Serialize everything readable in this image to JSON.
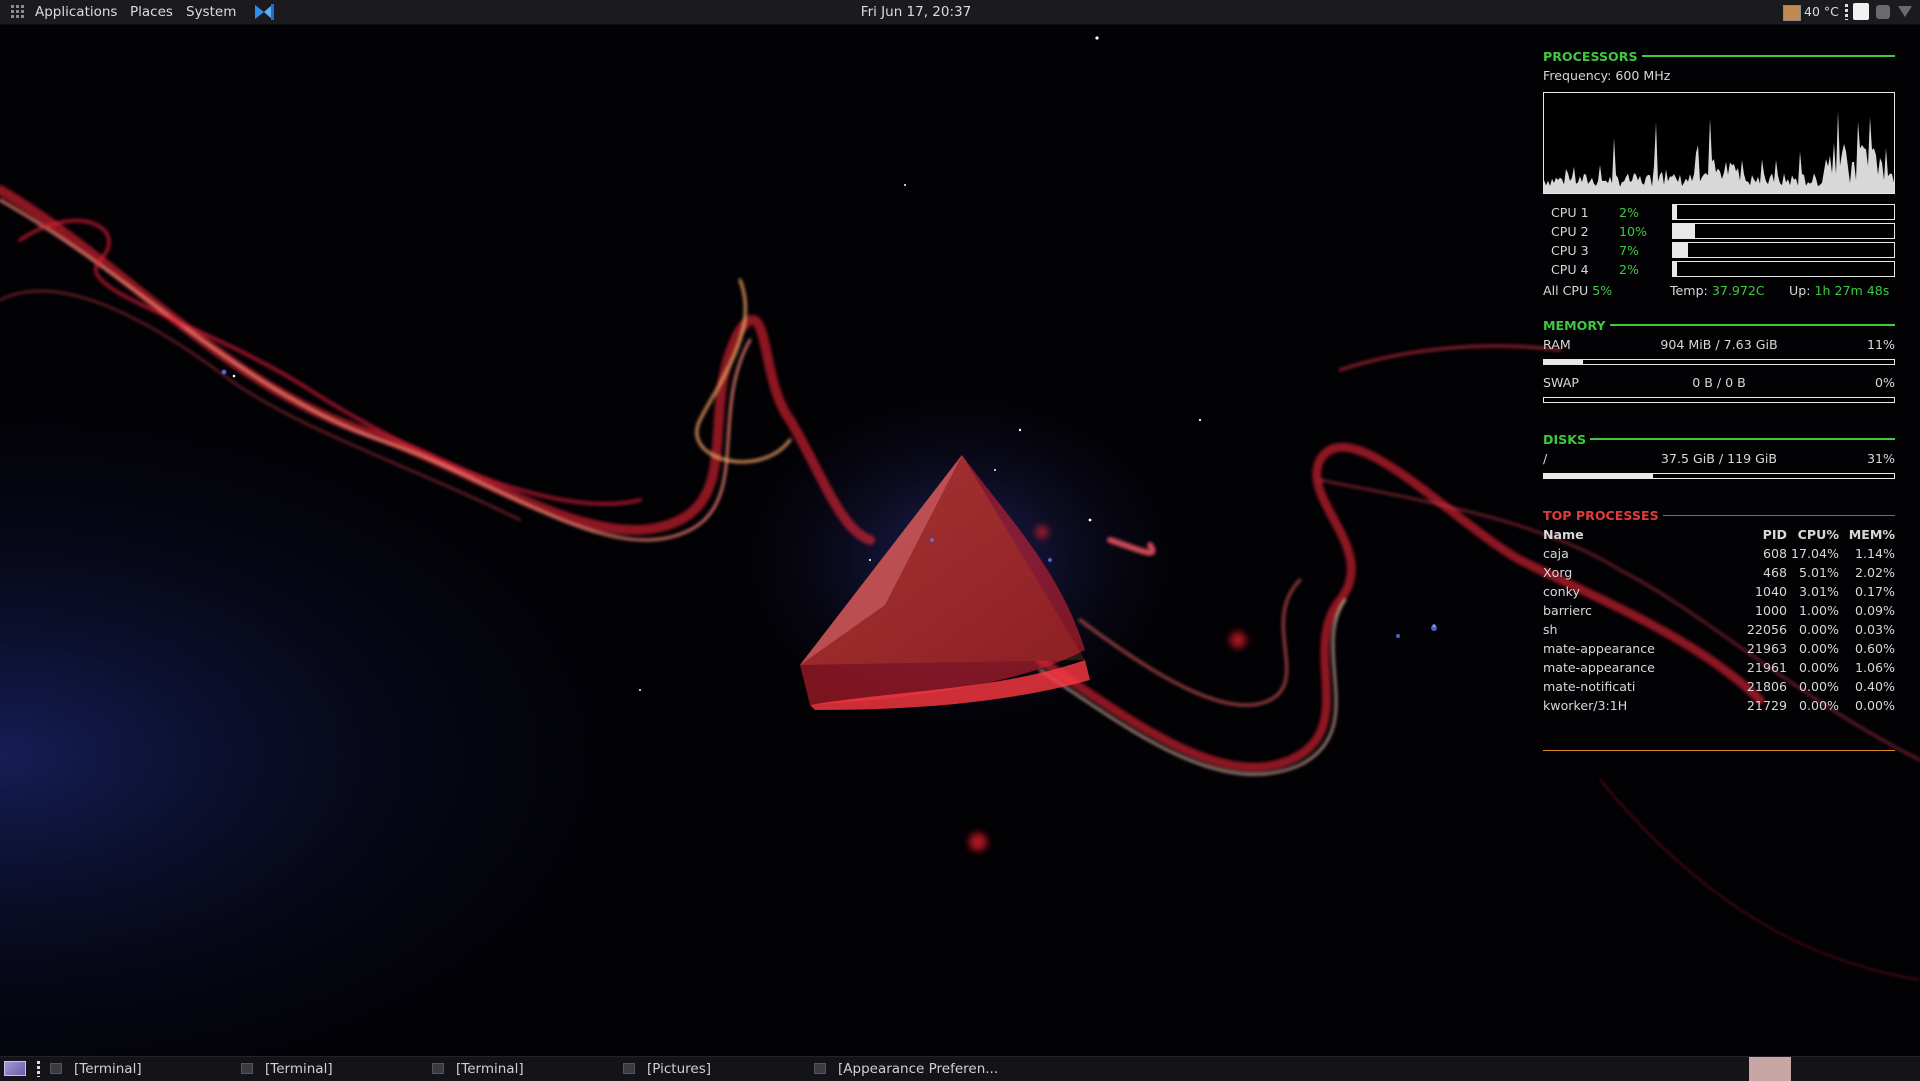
{
  "top_panel": {
    "menus": [
      "Applications",
      "Places",
      "System"
    ],
    "clock": "Fri Jun 17, 20:37",
    "temperature": "40 °C",
    "tray_icons": [
      "weather-icon",
      "network-icon",
      "volume-icon",
      "wifi-icon"
    ]
  },
  "conky": {
    "processors": {
      "title": "PROCESSORS",
      "frequency": "Frequency: 600 MHz",
      "cpus": [
        {
          "label": "CPU 1",
          "value": "2%",
          "fraction": 0.02
        },
        {
          "label": "CPU 2",
          "value": "10%",
          "fraction": 0.1
        },
        {
          "label": "CPU 3",
          "value": "7%",
          "fraction": 0.07
        },
        {
          "label": "CPU 4",
          "value": "2%",
          "fraction": 0.02
        }
      ],
      "all_cpu_label": "All CPU",
      "all_cpu_value": "5%",
      "temp_label": "Temp:",
      "temp_value": "37.972C",
      "uptime_label": "Up:",
      "uptime_value": "1h 27m 48s"
    },
    "memory": {
      "title": "MEMORY",
      "ram_label": "RAM",
      "ram_value": "904 MiB / 7.63 GiB",
      "ram_percent": "11%",
      "ram_fraction": 0.11,
      "swap_label": "SWAP",
      "swap_value": "0 B / 0 B",
      "swap_percent": "0%",
      "swap_fraction": 0
    },
    "disks": {
      "title": "DISKS",
      "mount": "/",
      "value": "37.5 GiB / 119 GiB",
      "percent": "31%",
      "fraction": 0.31
    },
    "top_processes": {
      "title": "TOP PROCESSES",
      "headers": {
        "name": "Name",
        "pid": "PID",
        "cpu": "CPU%",
        "mem": "MEM%"
      },
      "rows": [
        {
          "name": "caja",
          "pid": "608",
          "cpu": "17.04%",
          "mem": "1.14%"
        },
        {
          "name": "Xorg",
          "pid": "468",
          "cpu": "5.01%",
          "mem": "2.02%"
        },
        {
          "name": "conky",
          "pid": "1040",
          "cpu": "3.01%",
          "mem": "0.17%"
        },
        {
          "name": "barrierc",
          "pid": "1000",
          "cpu": "1.00%",
          "mem": "0.09%"
        },
        {
          "name": "sh",
          "pid": "22056",
          "cpu": "0.00%",
          "mem": "0.03%"
        },
        {
          "name": "mate-appearance",
          "pid": "21963",
          "cpu": "0.00%",
          "mem": "0.60%"
        },
        {
          "name": "mate-appearance",
          "pid": "21961",
          "cpu": "0.00%",
          "mem": "1.06%"
        },
        {
          "name": "mate-notificati",
          "pid": "21806",
          "cpu": "0.00%",
          "mem": "0.40%"
        },
        {
          "name": "kworker/3:1H",
          "pid": "21729",
          "cpu": "0.00%",
          "mem": "0.00%"
        }
      ]
    }
  },
  "taskbar": {
    "tasks": [
      "[Terminal]",
      "[Terminal]",
      "[Terminal]",
      "[Pictures]",
      "[Appearance Preferen..."
    ]
  },
  "colors": {
    "panel_bg": "#1a1a1f",
    "conky_green": "#3ec93e",
    "conky_red": "#e23b3b",
    "conky_orange": "#d98a2b",
    "wallpaper_red": "#ff2a3a"
  }
}
